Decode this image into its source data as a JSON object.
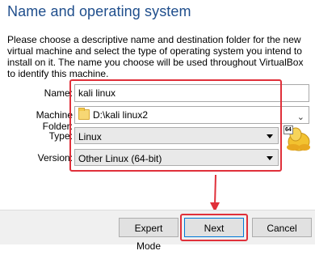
{
  "page": {
    "title": "Name and operating system",
    "description": "Please choose a descriptive name and destination folder for the new virtual machine and select the type of operating system you intend to install on it. The name you choose will be used throughout VirtualBox to identify this machine."
  },
  "form": {
    "name_label": "Name:",
    "name_value": "kali linux",
    "folder_label": "Machine Folder:",
    "folder_value": "D:\\kali linux2",
    "type_label": "Type:",
    "type_value": "Linux",
    "version_label": "Version:",
    "version_value": "Other Linux (64-bit)",
    "os_badge": "64"
  },
  "buttons": {
    "expert_mode": "Expert Mode",
    "next": "Next",
    "cancel": "Cancel"
  },
  "colors": {
    "title": "#1f4e8c",
    "highlight": "#e0303a"
  }
}
